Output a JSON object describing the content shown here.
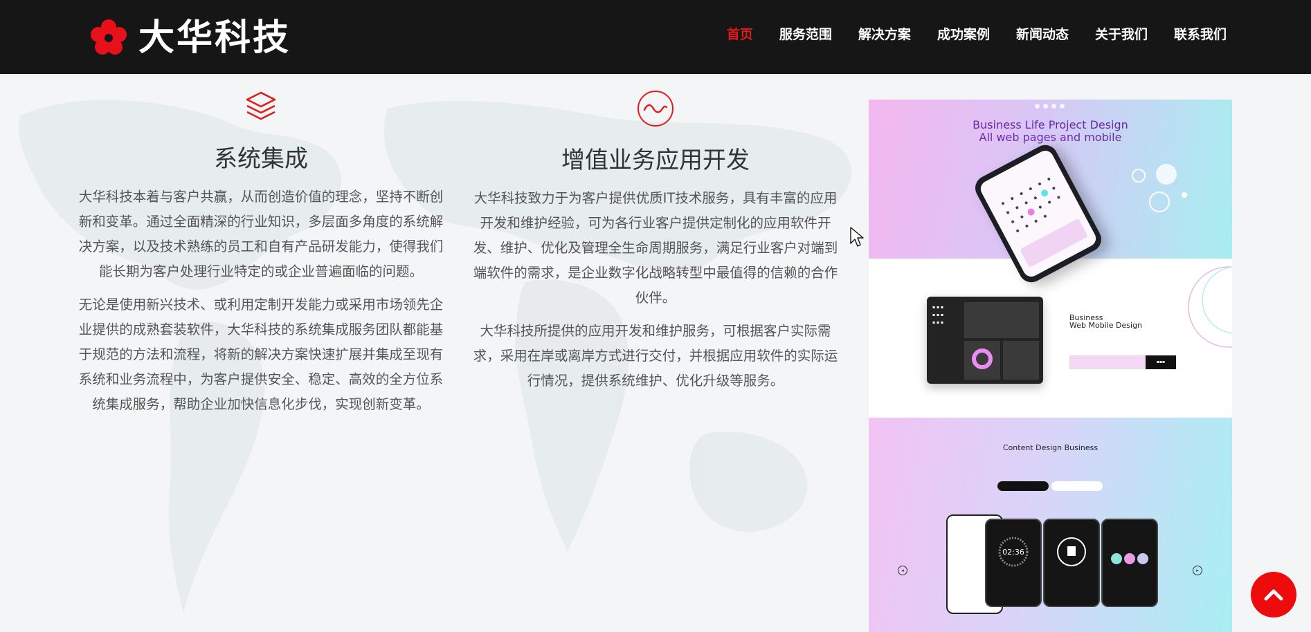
{
  "brand": {
    "name": "大华科技",
    "logo_icon": "flower-icon",
    "accent_color": "#e21b1b"
  },
  "nav": {
    "items": [
      {
        "label": "首页",
        "active": true
      },
      {
        "label": "服务范围",
        "active": false
      },
      {
        "label": "解决方案",
        "active": false
      },
      {
        "label": "成功案例",
        "active": false
      },
      {
        "label": "新闻动态",
        "active": false
      },
      {
        "label": "关于我们",
        "active": false
      },
      {
        "label": "联系我们",
        "active": false
      }
    ]
  },
  "sections": [
    {
      "icon": "layers-icon",
      "title": "系统集成",
      "paragraphs": [
        "大华科技本着与客户共赢，从而创造价值的理念，坚持不断创新和变革。通过全面精深的行业知识，多层面多角度的系统解决方案，以及技术熟练的员工和自有产品研发能力，使得我们能长期为客户处理行业特定的或企业普遍面临的问题。",
        "无论是使用新兴技术、或利用定制开发能力或采用市场领先企业提供的成熟套装软件，大华科技的系统集成服务团队都能基于规范的方法和流程，将新的解决方案快速扩展并集成至现有系统和业务流程中，为客户提供安全、稳定、高效的全方位系统集成服务，帮助企业加快信息化步伐，实现创新变革。"
      ]
    },
    {
      "icon": "wave-circle-icon",
      "title": "增值业务应用开发",
      "paragraphs": [
        "大华科技致力于为客户提供优质IT技术服务，具有丰富的应用开发和维护经验，可为各行业客户提供定制化的应用软件开发、维护、优化及管理全生命周期服务，满足行业客户对端到端软件的需求，是企业数字化战略转型中最值得的信赖的合作伙伴。",
        "大华科技所提供的应用开发和维护服务，可根据客户实际需求，采用在岸或离岸方式进行交付，并根据应用软件的实际运行情况，提供系统维护、优化升级等服务。"
      ]
    }
  ],
  "mockup": {
    "headline_line1": "Business Life Project Design",
    "headline_line2": "All web pages and mobile",
    "mid_title_1": "Business",
    "mid_title_2": "Web Mobile Design",
    "bottom_title": "Content Design Business",
    "clock_time": "02:36"
  },
  "back_to_top": {
    "icon": "chevron-up-icon"
  }
}
